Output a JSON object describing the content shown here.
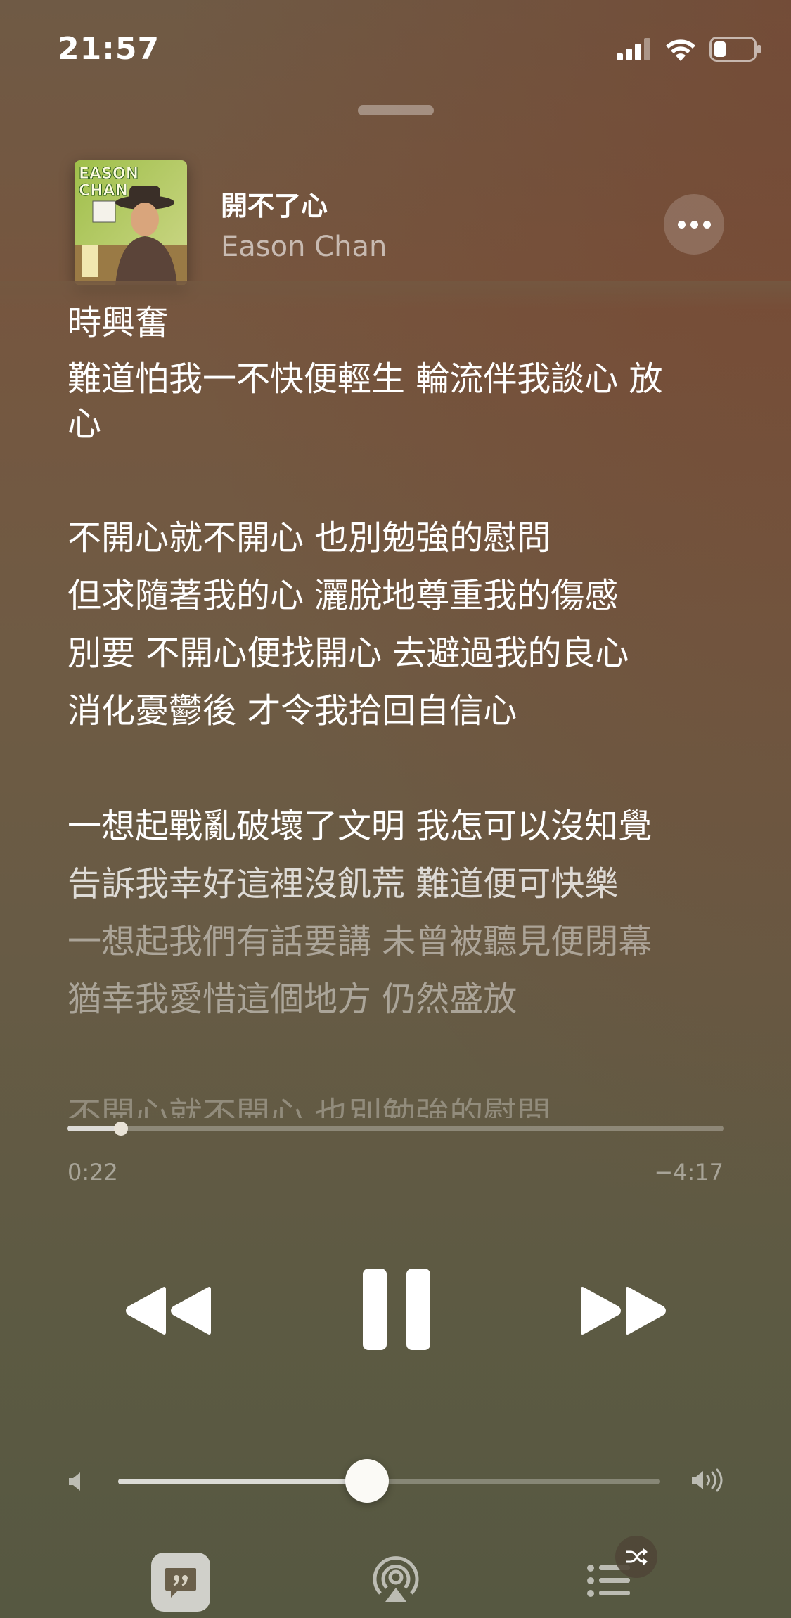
{
  "status_bar": {
    "time": "21:57"
  },
  "now_playing": {
    "title": "開不了心",
    "artist": "Eason Chan",
    "artwork_text": "EASON CHAN"
  },
  "lyrics": [
    {
      "text": "時興奮",
      "state": "normal"
    },
    {
      "text": "難道怕我一不快便輕生 輪流伴我談心 放",
      "state": "normal"
    },
    {
      "text": "心",
      "state": "normal"
    },
    {
      "text": "不開心就不開心 也別勉強的慰問",
      "state": "normal"
    },
    {
      "text": "但求隨著我的心 灑脫地尊重我的傷感",
      "state": "normal"
    },
    {
      "text": "別要 不開心便找開心 去避過我的良心",
      "state": "normal"
    },
    {
      "text": "消化憂鬱後 才令我拾回自信心",
      "state": "normal"
    },
    {
      "text": "一想起戰亂破壞了文明 我怎可以沒知覺",
      "state": "normal"
    },
    {
      "text": "告訴我幸好這裡沒飢荒 難道便可快樂",
      "state": "dim1"
    },
    {
      "text": "一想起我們有話要講 未曾被聽見便閉幕",
      "state": "dim2"
    },
    {
      "text": "猶幸我愛惜這個地方 仍然盛放",
      "state": "dim2"
    },
    {
      "text": "不開心就不開心 也別勉強的慰問",
      "state": "dim3"
    }
  ],
  "progress": {
    "elapsed": "0:22",
    "remaining": "−4:17",
    "fraction": 0.081
  },
  "volume": {
    "level": 0.46
  },
  "icons": {
    "rewind": "rewind-icon",
    "pause": "pause-icon",
    "forward": "fast-forward-icon",
    "more": "ellipsis-icon",
    "lyrics": "lyrics-quote-icon",
    "airplay": "airplay-icon",
    "queue": "queue-list-icon",
    "shuffle": "shuffle-icon"
  }
}
